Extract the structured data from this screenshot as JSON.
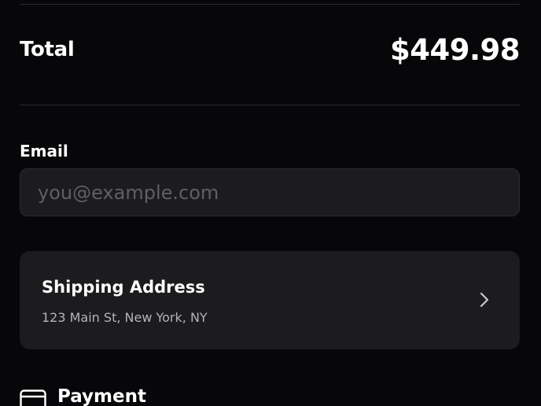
{
  "summary": {
    "total_label": "Total",
    "total_amount": "$449.98"
  },
  "email": {
    "label": "Email",
    "value": "",
    "placeholder": "you@example.com"
  },
  "shipping": {
    "title": "Shipping Address",
    "address": "123 Main St, New York, NY",
    "icon": "chevron-right-icon"
  },
  "payment": {
    "label": "Payment",
    "icon": "credit-card-icon"
  },
  "colors": {
    "background": "#070709",
    "surface": "#1c1c1e",
    "divider": "#2a2a2e",
    "text_primary": "#ffffff",
    "text_secondary": "#b3b3ba",
    "placeholder": "#5f5f66"
  }
}
